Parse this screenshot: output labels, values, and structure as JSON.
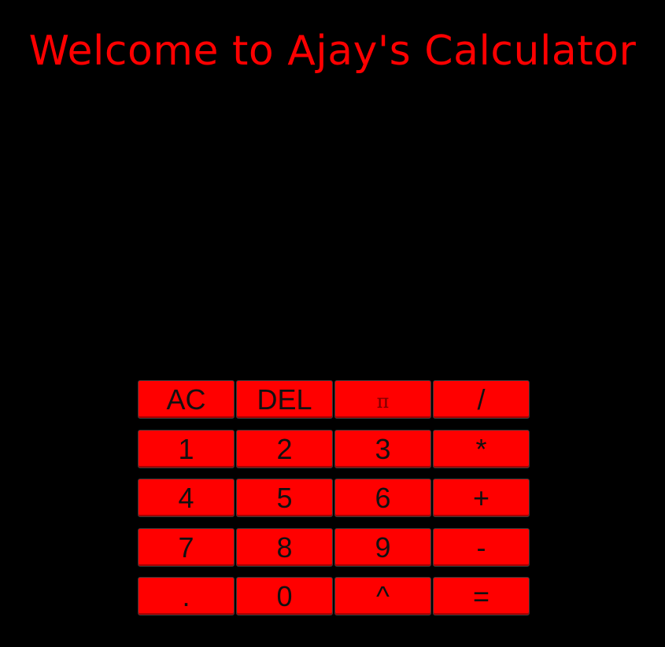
{
  "title": "Welcome to Ajay's Calculator",
  "display": {
    "value": ""
  },
  "keys": [
    {
      "name": "clear-all-button",
      "label": "AC",
      "cls": ""
    },
    {
      "name": "delete-button",
      "label": "DEL",
      "cls": ""
    },
    {
      "name": "pi-button",
      "label": "π",
      "cls": "pi"
    },
    {
      "name": "divide-button",
      "label": "/",
      "cls": ""
    },
    {
      "name": "digit-1-button",
      "label": "1",
      "cls": ""
    },
    {
      "name": "digit-2-button",
      "label": "2",
      "cls": ""
    },
    {
      "name": "digit-3-button",
      "label": "3",
      "cls": ""
    },
    {
      "name": "multiply-button",
      "label": "*",
      "cls": ""
    },
    {
      "name": "digit-4-button",
      "label": "4",
      "cls": ""
    },
    {
      "name": "digit-5-button",
      "label": "5",
      "cls": ""
    },
    {
      "name": "digit-6-button",
      "label": "6",
      "cls": ""
    },
    {
      "name": "add-button",
      "label": "+",
      "cls": ""
    },
    {
      "name": "digit-7-button",
      "label": "7",
      "cls": ""
    },
    {
      "name": "digit-8-button",
      "label": "8",
      "cls": ""
    },
    {
      "name": "digit-9-button",
      "label": "9",
      "cls": ""
    },
    {
      "name": "subtract-button",
      "label": "-",
      "cls": ""
    },
    {
      "name": "decimal-point-button",
      "label": ".",
      "cls": ""
    },
    {
      "name": "digit-0-button",
      "label": "0",
      "cls": ""
    },
    {
      "name": "power-button",
      "label": "^",
      "cls": ""
    },
    {
      "name": "equals-button",
      "label": "=",
      "cls": ""
    }
  ],
  "colors": {
    "background": "#000000",
    "accent": "#ff0000",
    "key_text": "#111111"
  }
}
